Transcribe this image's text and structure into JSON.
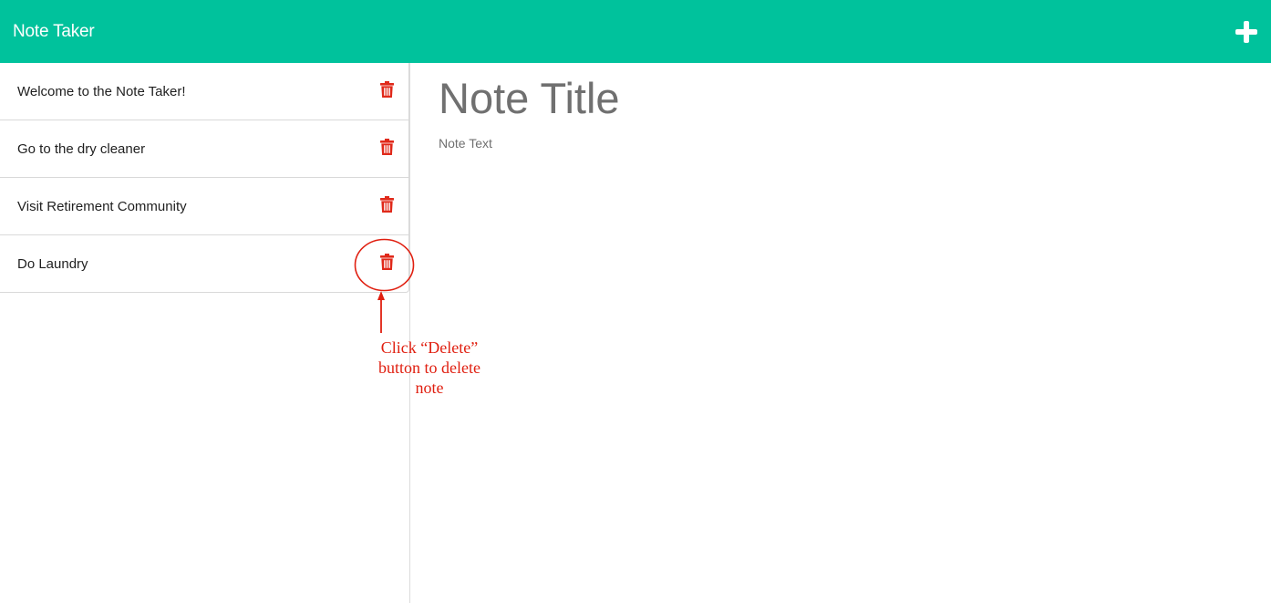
{
  "app": {
    "title": "Note Taker",
    "add_icon": "plus-icon"
  },
  "notes": [
    {
      "title": "Welcome to the Note Taker!",
      "delete_icon": "trash-icon"
    },
    {
      "title": "Go to the dry cleaner",
      "delete_icon": "trash-icon"
    },
    {
      "title": "Visit Retirement Community",
      "delete_icon": "trash-icon"
    },
    {
      "title": "Do Laundry",
      "delete_icon": "trash-icon"
    }
  ],
  "editor": {
    "title_placeholder": "Note Title",
    "text_placeholder": "Note Text"
  },
  "annotation": {
    "lines": [
      "Click “Delete”",
      "button to delete",
      "note"
    ]
  },
  "colors": {
    "navbar": "#00c29c",
    "delete": "#e0291a",
    "annotation": "#e01f10"
  }
}
